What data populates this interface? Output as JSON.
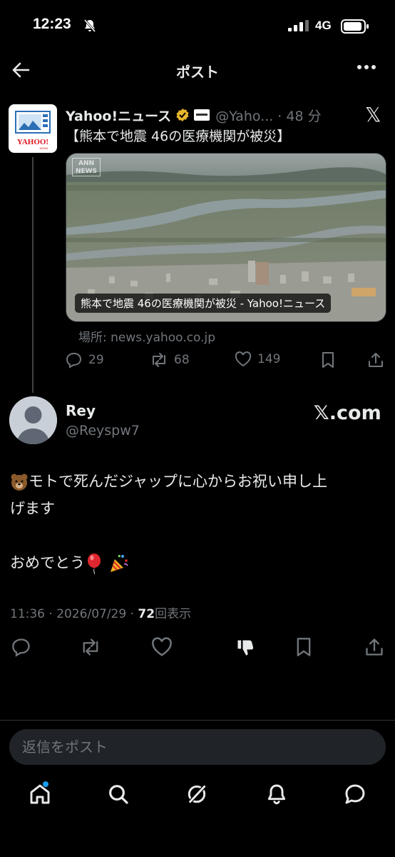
{
  "status_bar": {
    "time": "12:23",
    "network": "4G"
  },
  "nav": {
    "title": "ポスト"
  },
  "quoted_post": {
    "author_name": "Yahoo!ニュース",
    "handle_time": "@Yaho... · 48 分",
    "text": "【熊本で地震 46の医療機関が被災】",
    "card": {
      "badge": "ANN NEWS",
      "caption": "熊本で地震 46の医療機関が被災 - Yahoo!ニュース"
    },
    "source": "場所: news.yahoo.co.jp",
    "stats": {
      "replies": "29",
      "reposts": "68",
      "likes": "149"
    }
  },
  "post": {
    "author_name": "Rey",
    "handle": "@Reyspw7",
    "brand": "𝕏.com",
    "line1": "モトで死んだジャップに心からお祝い申し上",
    "line2": "げます",
    "line3": "おめでとう",
    "meta_prefix": "11:36 · 2026/07/29 · ",
    "views": "72",
    "views_label": "回表示"
  },
  "reply": {
    "placeholder": "返信をポスト"
  },
  "colors": {
    "background": "#000000",
    "accent": "#1d9bf0",
    "muted": "#71767b",
    "text": "#e7e9ea"
  },
  "icons": [
    "back-arrow-icon",
    "more-icon",
    "x-logo-icon",
    "reply-icon",
    "repost-icon",
    "like-icon",
    "bookmark-icon",
    "share-icon",
    "dislike-icon",
    "home-icon",
    "search-icon",
    "grok-icon",
    "notifications-icon",
    "messages-icon"
  ]
}
